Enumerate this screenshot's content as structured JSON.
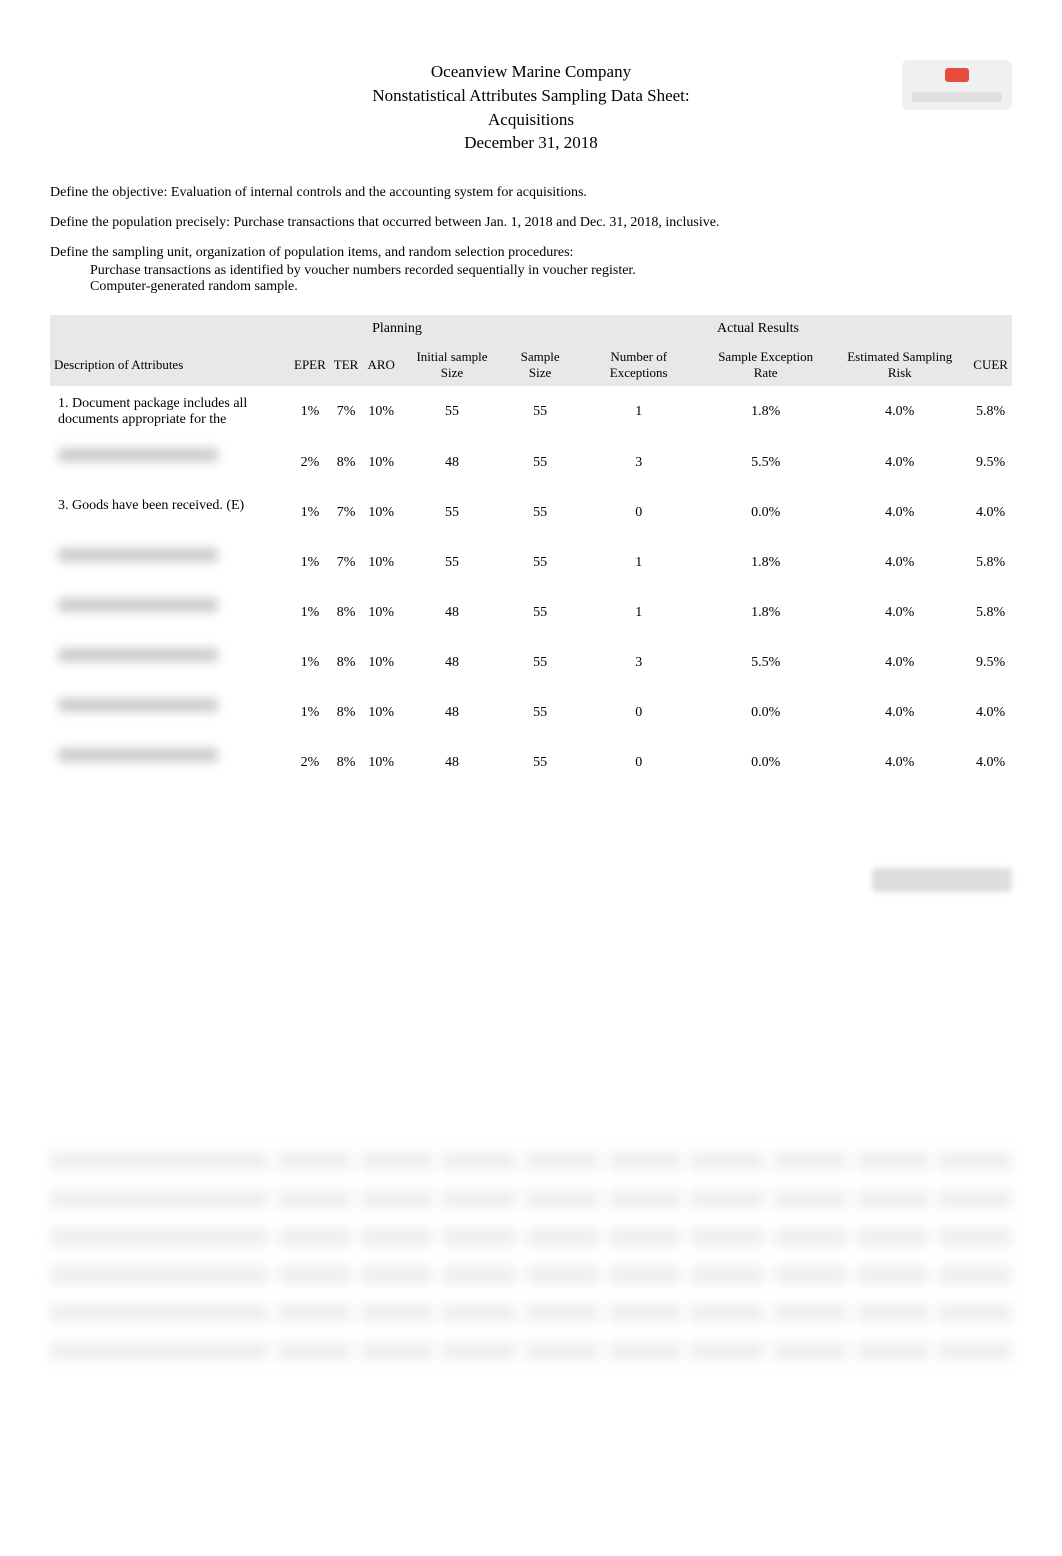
{
  "header": {
    "company": "Oceanview Marine Company",
    "doc_title": "Nonstatistical Attributes Sampling Data Sheet:",
    "subject": "Acquisitions",
    "date": "December 31, 2018"
  },
  "definitions": {
    "objective_label": "Define the objective:",
    "objective_value": "Evaluation of internal controls and the accounting system for acquisitions.",
    "population_label": "Define the population precisely:",
    "population_value": "Purchase transactions that occurred between Jan. 1, 2018 and Dec. 31, 2018, inclusive.",
    "sampling_label": "Define the sampling unit, organization of population items, and random selection procedures:",
    "sampling_sub1": "Purchase transactions as identified by voucher numbers recorded sequentially in voucher register.",
    "sampling_sub2": "Computer-generated random sample."
  },
  "table": {
    "group_planning": "Planning",
    "group_actual": "Actual Results",
    "columns": {
      "desc": "Description of Attributes",
      "eper": "EPER",
      "ter": "TER",
      "aro": "ARO",
      "initial": "Initial sample Size",
      "sample": "Sample Size",
      "exceptions": "Number of Exceptions",
      "ser": "Sample Exception Rate",
      "esr": "Estimated Sampling Risk",
      "cuer": "CUER"
    },
    "rows": [
      {
        "desc": "1. Document package includes all documents appropriate for the",
        "eper": "1%",
        "ter": "7%",
        "aro": "10%",
        "initial": "55",
        "sample": "55",
        "exceptions": "1",
        "ser": "1.8%",
        "esr": "4.0%",
        "cuer": "5.8%"
      },
      {
        "desc": "",
        "eper": "2%",
        "ter": "8%",
        "aro": "10%",
        "initial": "48",
        "sample": "55",
        "exceptions": "3",
        "ser": "5.5%",
        "esr": "4.0%",
        "cuer": "9.5%"
      },
      {
        "desc": "3. Goods have been received. (E)",
        "eper": "1%",
        "ter": "7%",
        "aro": "10%",
        "initial": "55",
        "sample": "55",
        "exceptions": "0",
        "ser": "0.0%",
        "esr": "4.0%",
        "cuer": "4.0%"
      },
      {
        "desc": "",
        "eper": "1%",
        "ter": "7%",
        "aro": "10%",
        "initial": "55",
        "sample": "55",
        "exceptions": "1",
        "ser": "1.8%",
        "esr": "4.0%",
        "cuer": "5.8%"
      },
      {
        "desc": "",
        "eper": "1%",
        "ter": "8%",
        "aro": "10%",
        "initial": "48",
        "sample": "55",
        "exceptions": "1",
        "ser": "1.8%",
        "esr": "4.0%",
        "cuer": "5.8%"
      },
      {
        "desc": "",
        "eper": "1%",
        "ter": "8%",
        "aro": "10%",
        "initial": "48",
        "sample": "55",
        "exceptions": "3",
        "ser": "5.5%",
        "esr": "4.0%",
        "cuer": "9.5%"
      },
      {
        "desc": "",
        "eper": "1%",
        "ter": "8%",
        "aro": "10%",
        "initial": "48",
        "sample": "55",
        "exceptions": "0",
        "ser": "0.0%",
        "esr": "4.0%",
        "cuer": "4.0%"
      },
      {
        "desc": "",
        "eper": "2%",
        "ter": "8%",
        "aro": "10%",
        "initial": "48",
        "sample": "55",
        "exceptions": "0",
        "ser": "0.0%",
        "esr": "4.0%",
        "cuer": "4.0%"
      }
    ]
  }
}
